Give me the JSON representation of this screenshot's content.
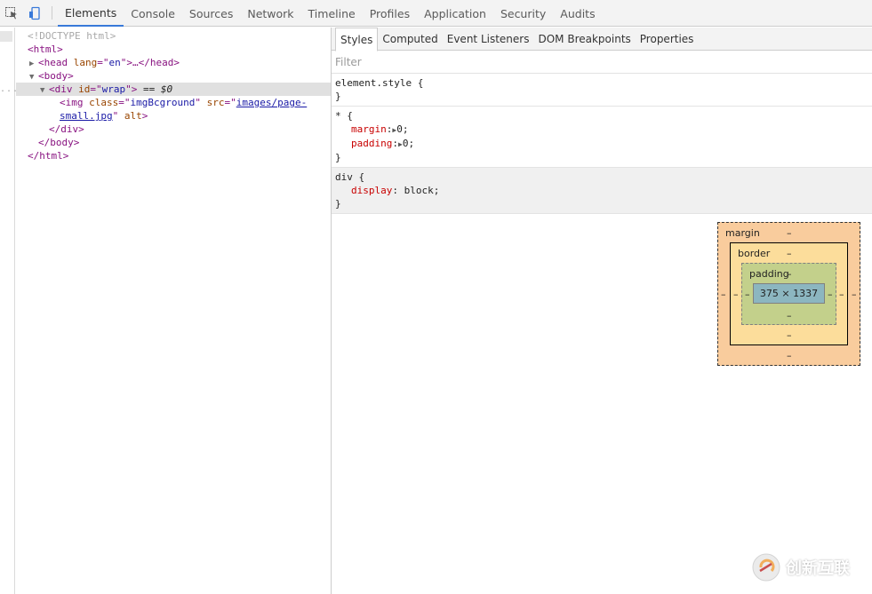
{
  "toolbar": {
    "tabs": [
      {
        "label": "Elements",
        "active": true
      },
      {
        "label": "Console"
      },
      {
        "label": "Sources"
      },
      {
        "label": "Network"
      },
      {
        "label": "Timeline"
      },
      {
        "label": "Profiles"
      },
      {
        "label": "Application"
      },
      {
        "label": "Security"
      },
      {
        "label": "Audits"
      }
    ]
  },
  "dom": {
    "doctype": "<!DOCTYPE html>",
    "html_open": "<html>",
    "head_tag_open": "<head",
    "head_attr": "lang",
    "head_attr_value": "en",
    "head_collapsed": ">…</head>",
    "body_open": "<body>",
    "div_open": "<div",
    "div_attr": "id",
    "div_attr_value": "wrap",
    "div_close_bracket": ">",
    "selected_marker": " == $0",
    "img_open": "<img",
    "img_class_attr": "class",
    "img_class_value": "imgBcground",
    "img_src_attr": "src",
    "img_src_value": "images/page-small.jpg",
    "img_alt_attr": "alt",
    "img_close": ">",
    "div_close": "</div>",
    "body_close": "</body>",
    "html_close": "</html>",
    "dots": "..."
  },
  "styles": {
    "subtabs": [
      {
        "label": "Styles",
        "active": true
      },
      {
        "label": "Computed"
      },
      {
        "label": "Event Listeners"
      },
      {
        "label": "DOM Breakpoints"
      },
      {
        "label": "Properties"
      }
    ],
    "filter_placeholder": "Filter",
    "element_style_selector": "element.style {",
    "close_brace": "}",
    "universal_selector": "* {",
    "margin_prop": "margin",
    "margin_value": "0",
    "padding_prop": "padding",
    "padding_value": "0",
    "div_selector": "div {",
    "display_prop": "display",
    "display_value": "block"
  },
  "box_model": {
    "margin_label": "margin",
    "border_label": "border",
    "padding_label": "padding",
    "dash": "–",
    "content_size": "375 × 1337",
    "colors": {
      "margin": "#f9cc9d",
      "border": "#fcdd9b",
      "padding": "#c3d08b",
      "content": "#8cb6c0"
    }
  },
  "watermark": {
    "text": "创新互联"
  },
  "icons": {
    "inspect": "inspect-element-icon",
    "device": "device-mode-icon",
    "expand": "triangle-right-icon",
    "collapse": "triangle-down-icon"
  }
}
